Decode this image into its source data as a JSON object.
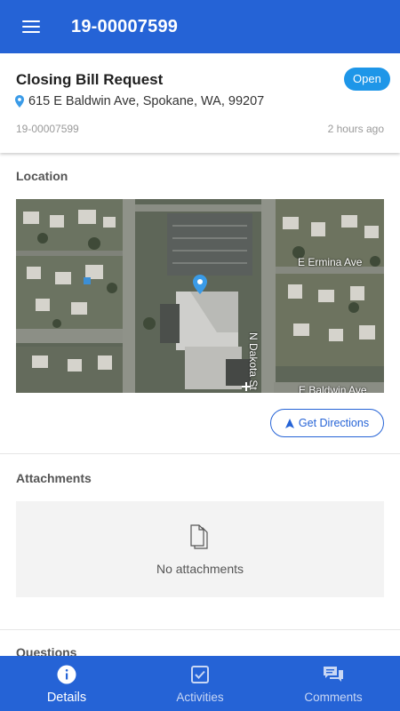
{
  "header": {
    "title": "19-00007599",
    "menu_icon": "hamburger-menu-icon"
  },
  "request": {
    "title": "Closing Bill Request",
    "status": "Open",
    "address": "615 E Baldwin Ave, Spokane, WA, 99207",
    "id": "19-00007599",
    "time_ago": "2 hours ago"
  },
  "location": {
    "heading": "Location",
    "map_labels": {
      "street_1": "E Ermina Ave",
      "street_2": "N Dakota St",
      "street_3": "E Baldwin Ave"
    },
    "directions_label": "Get Directions"
  },
  "attachments": {
    "heading": "Attachments",
    "empty_text": "No attachments"
  },
  "questions": {
    "heading": "Questions"
  },
  "nav": {
    "tabs": [
      {
        "label": "Details",
        "icon": "info-icon",
        "active": true
      },
      {
        "label": "Activities",
        "icon": "checkbox-icon",
        "active": false
      },
      {
        "label": "Comments",
        "icon": "comments-icon",
        "active": false
      }
    ]
  },
  "colors": {
    "primary": "#2563d6",
    "badge": "#1e96e8",
    "pin": "#3a9be8"
  }
}
